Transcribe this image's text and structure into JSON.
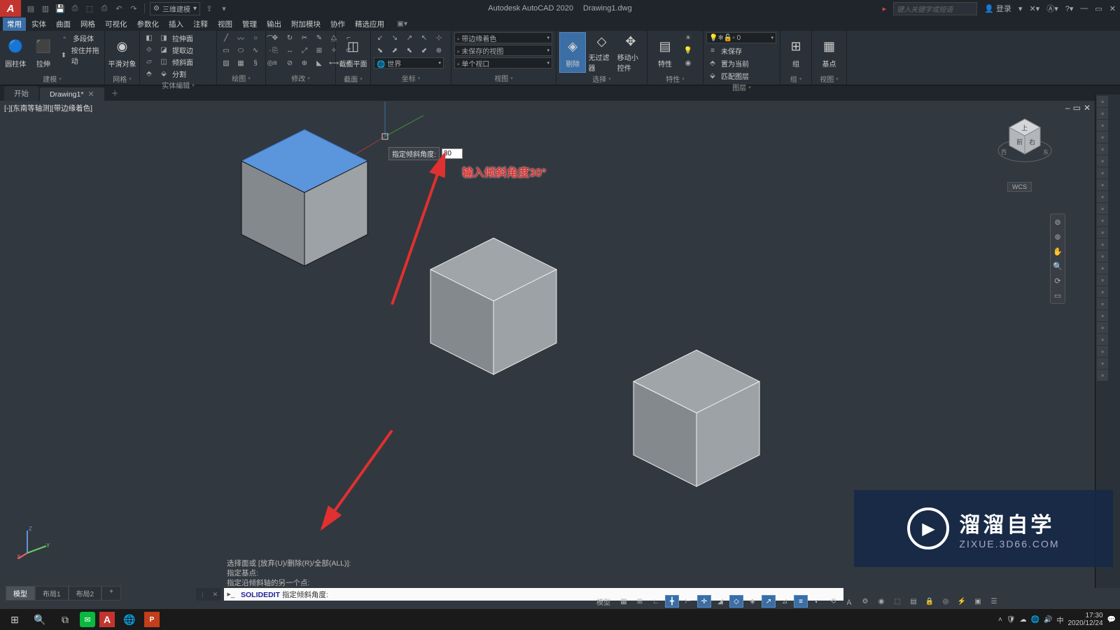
{
  "title": {
    "app": "Autodesk AutoCAD 2020",
    "file": "Drawing1.dwg"
  },
  "search": {
    "placeholder": "键入关键字或短语"
  },
  "account": {
    "label": "登录"
  },
  "workspace": {
    "current": "三维建模"
  },
  "menubar": [
    "常用",
    "实体",
    "曲面",
    "网格",
    "可视化",
    "参数化",
    "插入",
    "注释",
    "视图",
    "管理",
    "输出",
    "附加模块",
    "协作",
    "精选应用"
  ],
  "ribbon": {
    "panels": [
      {
        "label": "建模",
        "items": [
          "圆柱体",
          "拉伸"
        ],
        "rows": [
          "多段体",
          "按住并拖动"
        ]
      },
      {
        "label": "网格",
        "items": [
          "平滑对象"
        ]
      },
      {
        "label": "实体编辑",
        "rows": [
          "拉伸面",
          "提取边",
          "倾斜面",
          "分割"
        ]
      },
      {
        "label": "绘图"
      },
      {
        "label": "修改"
      },
      {
        "label": "截面",
        "items": [
          "截面平面"
        ]
      },
      {
        "label": "坐标",
        "combo": "世界"
      },
      {
        "label": "视图",
        "combos": [
          "带边缘着色",
          "未保存的视图",
          "单个视口"
        ]
      },
      {
        "label": "选择",
        "items": [
          "剔除",
          "无过滤器",
          "移动小控件"
        ]
      },
      {
        "label": "特性",
        "items": [
          "特性"
        ]
      },
      {
        "label": "图层",
        "combo": "0",
        "rows": [
          "未保存",
          "置为当前",
          "匹配图层"
        ]
      },
      {
        "label": "组",
        "items": [
          "组"
        ]
      },
      {
        "label": "视图",
        "items": [
          "基点"
        ]
      }
    ]
  },
  "doc_tabs": [
    {
      "label": "开始"
    },
    {
      "label": "Drawing1*",
      "active": true
    }
  ],
  "viewport": {
    "label": "[-][东南等轴测][带边缘着色]"
  },
  "dynamic_input": {
    "prompt": "指定倾斜角度:",
    "value": "30"
  },
  "annotation": {
    "text": "输入倾斜角度30°"
  },
  "wcs": "WCS",
  "cmd_history": [
    "选择面或 [放弃(U)/删除(R)/全部(ALL)]:",
    "指定基点:",
    "指定沿倾斜轴的另一个点:"
  ],
  "cmd_line": {
    "cmd": "SOLIDEDIT",
    "prompt": "指定倾斜角度:"
  },
  "model_tabs": [
    "模型",
    "布局1",
    "布局2"
  ],
  "status_label": "模型",
  "watermark": {
    "line1": "溜溜自学",
    "line2": "ZIXUE.3D66.COM"
  },
  "clock": {
    "time": "17:30",
    "date": "2020/12/24"
  }
}
